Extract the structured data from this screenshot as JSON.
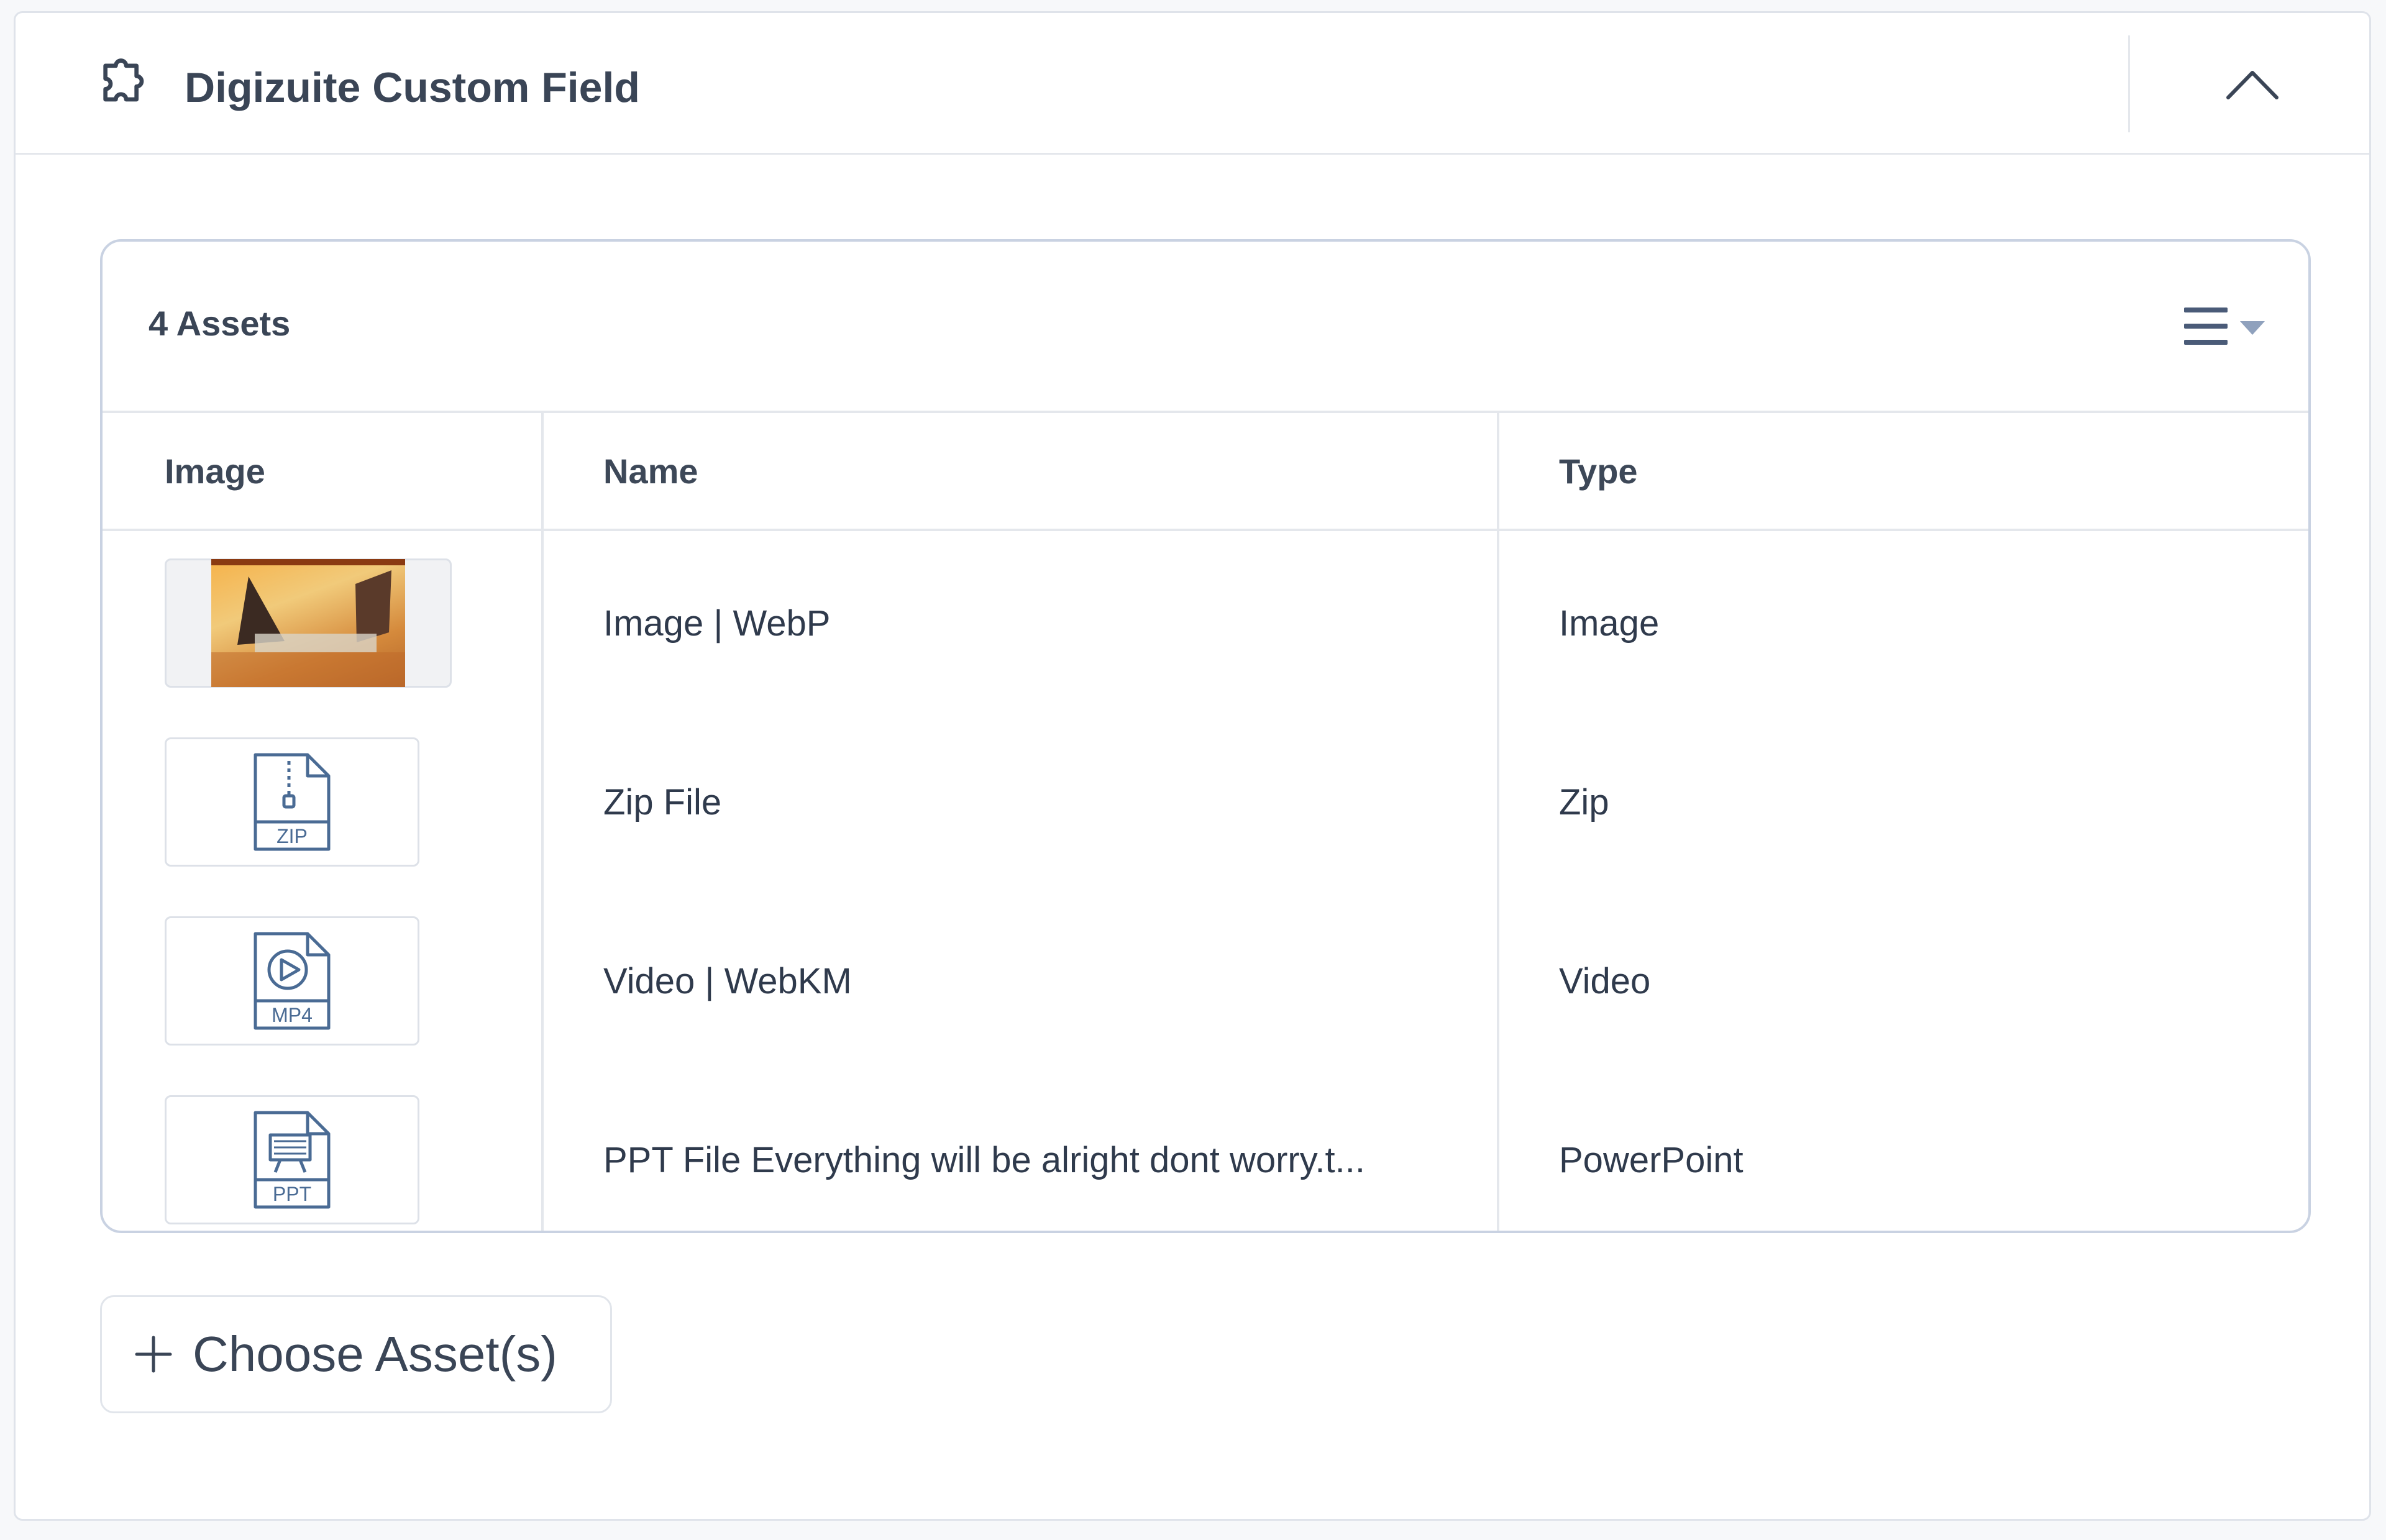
{
  "panel": {
    "title": "Digizuite Custom Field"
  },
  "assets": {
    "count_label": "4 Assets",
    "columns": {
      "image": "Image",
      "name": "Name",
      "type": "Type"
    },
    "rows": [
      {
        "thumb": "photo",
        "name": "Image | WebP",
        "type": "Image"
      },
      {
        "thumb": "ZIP",
        "name": "Zip File",
        "type": "Zip"
      },
      {
        "thumb": "MP4",
        "name": "Video | WebKM",
        "type": "Video"
      },
      {
        "thumb": "PPT",
        "name": "PPT File Everything will be alright dont worry.t...",
        "type": "PowerPoint"
      }
    ]
  },
  "actions": {
    "choose_label": "Choose Asset(s)"
  },
  "colors": {
    "accent_icon": "#4a6b94",
    "text": "#2f3a4c",
    "border": "#c9d2e2"
  },
  "icons": {
    "header": "puzzle-plugin-icon",
    "collapse": "chevron-up-icon",
    "view": "list-view-icon"
  }
}
